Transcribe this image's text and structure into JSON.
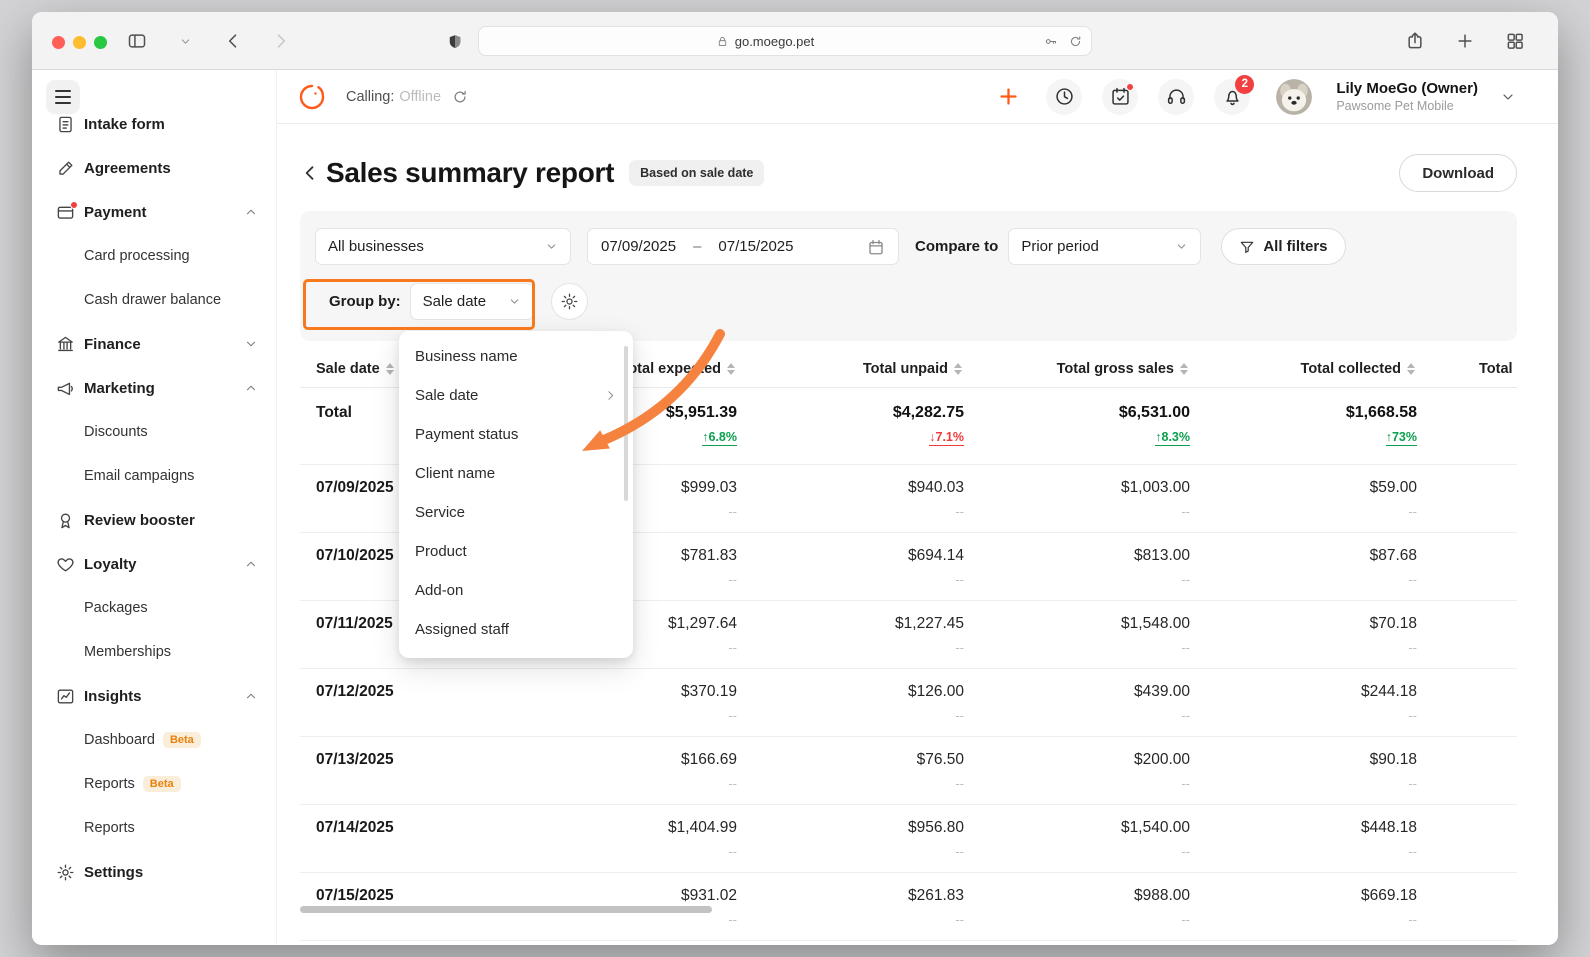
{
  "colors": {
    "accent": "#fe5b19",
    "green": "#0aa04d",
    "red": "#ee3a3a",
    "annotation": "#f5833f"
  },
  "browser": {
    "url": "go.moego.pet"
  },
  "topbar": {
    "calling_label": "Calling:",
    "calling_status": "Offline",
    "notification_count": "2",
    "user_name": "Lily MoeGo (Owner)",
    "user_org": "Pawsome Pet Mobile"
  },
  "sidebar": {
    "items": [
      {
        "label": "Intake form",
        "icon": "intake-form-icon"
      },
      {
        "label": "Agreements",
        "icon": "agreements-icon"
      },
      {
        "label": "Payment",
        "icon": "payment-icon",
        "chevron": "up",
        "dot": true
      },
      {
        "label": "Card processing",
        "indent": 1
      },
      {
        "label": "Cash drawer balance",
        "indent": 1
      },
      {
        "label": "Finance",
        "icon": "finance-icon",
        "chevron": "down"
      },
      {
        "label": "Marketing",
        "icon": "marketing-icon",
        "chevron": "up"
      },
      {
        "label": "Discounts",
        "indent": 1
      },
      {
        "label": "Email campaigns",
        "indent": 1
      },
      {
        "label": "Review booster",
        "icon": "review-booster-icon"
      },
      {
        "label": "Loyalty",
        "icon": "loyalty-icon",
        "chevron": "up"
      },
      {
        "label": "Packages",
        "indent": 1
      },
      {
        "label": "Memberships",
        "indent": 1
      },
      {
        "label": "Insights",
        "icon": "insights-icon",
        "chevron": "up"
      },
      {
        "label": "Dashboard",
        "indent": 1,
        "badge": "Beta"
      },
      {
        "label": "Reports",
        "indent": 1,
        "badge": "Beta"
      },
      {
        "label": "Reports",
        "indent": 1
      },
      {
        "label": "Settings",
        "icon": "settings-icon"
      }
    ]
  },
  "page": {
    "title": "Sales summary report",
    "badge": "Based on sale date",
    "download_label": "Download"
  },
  "filters": {
    "business": "All businesses",
    "date_start": "07/09/2025",
    "date_separator": "–",
    "date_end": "07/15/2025",
    "compare_label": "Compare to",
    "compare_value": "Prior period",
    "all_filters_label": "All filters",
    "group_by_label": "Group by:",
    "group_by_value": "Sale date"
  },
  "dropdown": {
    "items": [
      "Business name",
      "Sale date",
      "Payment status",
      "Client name",
      "Service",
      "Product",
      "Add-on",
      "Assigned staff"
    ]
  },
  "table": {
    "columns": [
      "Sale date",
      "Total expected",
      "Total unpaid",
      "Total gross sales",
      "Total collected",
      "Total"
    ],
    "placeholder": "--",
    "total_row": {
      "label": "Total",
      "cells": [
        {
          "value": "$5,951.39",
          "arrow": "↑",
          "change": "6.8%",
          "trend": "up"
        },
        {
          "value": "$4,282.75",
          "arrow": "↓",
          "change": "7.1%",
          "trend": "down"
        },
        {
          "value": "$6,531.00",
          "arrow": "↑",
          "change": "8.3%",
          "trend": "up"
        },
        {
          "value": "$1,668.58",
          "arrow": "↑",
          "change": "73%",
          "trend": "up"
        }
      ]
    },
    "rows": [
      {
        "date": "07/09/2025",
        "cells": [
          "$999.03",
          "$940.03",
          "$1,003.00",
          "$59.00"
        ]
      },
      {
        "date": "07/10/2025",
        "cells": [
          "$781.83",
          "$694.14",
          "$813.00",
          "$87.68"
        ]
      },
      {
        "date": "07/11/2025",
        "cells": [
          "$1,297.64",
          "$1,227.45",
          "$1,548.00",
          "$70.18"
        ]
      },
      {
        "date": "07/12/2025",
        "cells": [
          "$370.19",
          "$126.00",
          "$439.00",
          "$244.18"
        ]
      },
      {
        "date": "07/13/2025",
        "cells": [
          "$166.69",
          "$76.50",
          "$200.00",
          "$90.18"
        ]
      },
      {
        "date": "07/14/2025",
        "cells": [
          "$1,404.99",
          "$956.80",
          "$1,540.00",
          "$448.18"
        ]
      },
      {
        "date": "07/15/2025",
        "cells": [
          "$931.02",
          "$261.83",
          "$988.00",
          "$669.18"
        ]
      }
    ]
  }
}
